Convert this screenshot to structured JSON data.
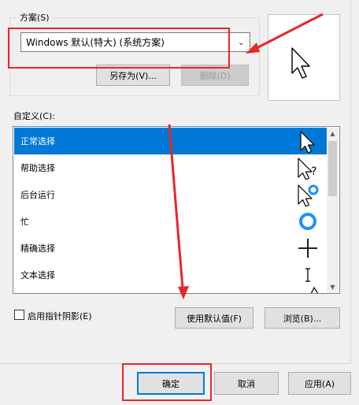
{
  "scheme": {
    "legend": "方案(S)",
    "selected_value": "Windows 默认(特大) (系统方案)",
    "save_as_label": "另存为(V)...",
    "delete_label": "删除(D)"
  },
  "customize": {
    "label": "自定义(C):",
    "items": [
      {
        "label": "正常选择",
        "icon": "arrow-cursor-icon"
      },
      {
        "label": "帮助选择",
        "icon": "help-cursor-icon"
      },
      {
        "label": "后台运行",
        "icon": "working-in-background-cursor-icon"
      },
      {
        "label": "忙",
        "icon": "busy-cursor-icon"
      },
      {
        "label": "精确选择",
        "icon": "crosshair-cursor-icon"
      },
      {
        "label": "文本选择",
        "icon": "text-ibeam-cursor-icon"
      }
    ]
  },
  "options": {
    "shadow_label": "启用指针阴影(E)",
    "use_default_label": "使用默认值(F)",
    "browse_label": "浏览(B)..."
  },
  "footer": {
    "ok_label": "确定",
    "cancel_label": "取消",
    "apply_label": "应用(A)"
  },
  "colors": {
    "selection": "#0078d7",
    "annotation": "#e8262b"
  }
}
